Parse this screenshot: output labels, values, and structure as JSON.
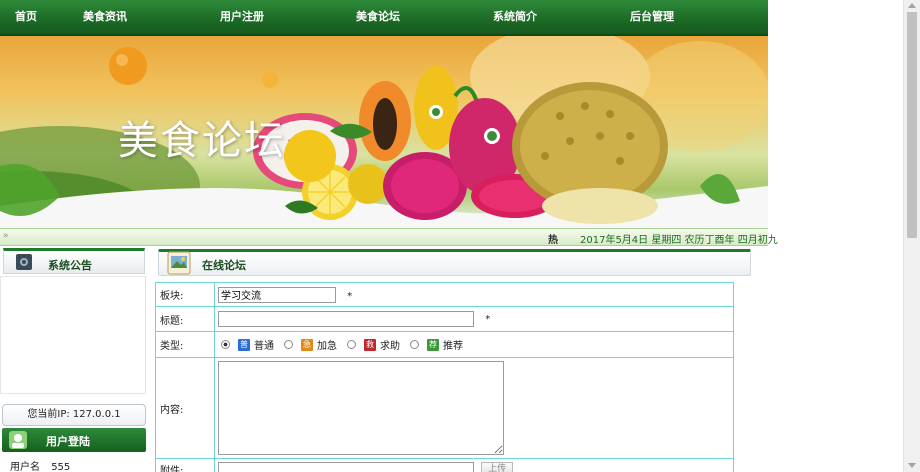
{
  "nav": {
    "items": [
      "首页",
      "美食资讯",
      "用户注册",
      "美食论坛",
      "系统简介",
      "后台管理"
    ]
  },
  "banner": {
    "title": "美食论坛"
  },
  "ticker": {
    "hot": "热",
    "date": "2017年5月4日 星期四 农历丁酉年 四月初九"
  },
  "sidebar": {
    "notice_title": "系统公告",
    "ip_text": "您当前IP: 127.0.0.1",
    "login_title": "用户登陆",
    "username_label": "用户名",
    "username_value": "555"
  },
  "forum": {
    "title": "在线论坛",
    "form": {
      "board_label": "板块:",
      "board_value": "学习交流",
      "title_label": "标题:",
      "title_value": "",
      "required_mark": "*",
      "type_label": "类型:",
      "types": [
        {
          "label": "普通",
          "icon": "普",
          "color": "#2b6cd6",
          "selected": true
        },
        {
          "label": "加急",
          "icon": "急",
          "color": "#e08a1a",
          "selected": false
        },
        {
          "label": "求助",
          "icon": "救",
          "color": "#c0282d",
          "selected": false
        },
        {
          "label": "推荐",
          "icon": "荐",
          "color": "#3a9a3a",
          "selected": false
        }
      ],
      "content_label": "内容:",
      "attachment_label": "附件:",
      "upload_label": "上传"
    }
  },
  "colors": {
    "nav_green": "#1c6a26",
    "table_border": "#6fd6d6"
  }
}
